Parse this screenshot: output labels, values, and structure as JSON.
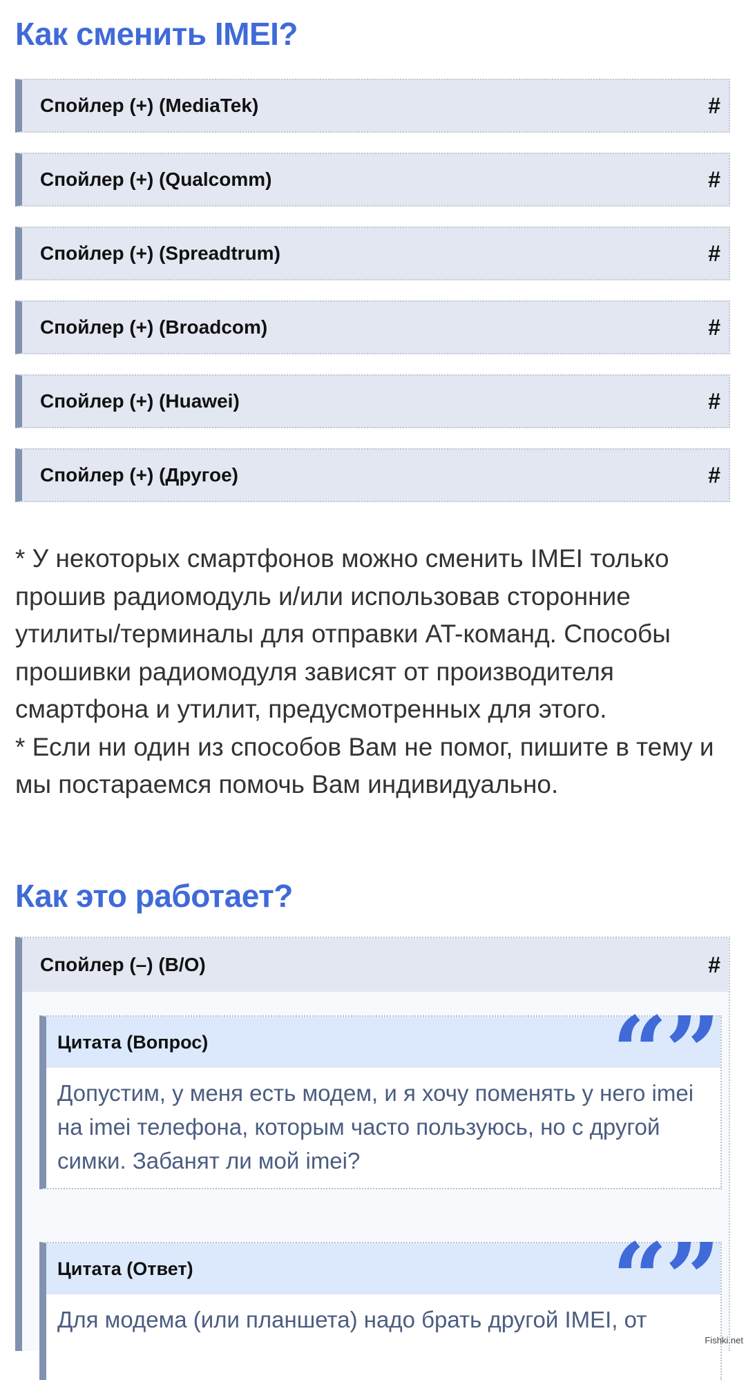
{
  "section1": {
    "title": "Как сменить IMEI?",
    "spoilers": [
      {
        "label": "Спойлер (+) (MediaTek)",
        "anchor": "#"
      },
      {
        "label": "Спойлер (+) (Qualcomm)",
        "anchor": "#"
      },
      {
        "label": "Спойлер (+) (Spreadtrum)",
        "anchor": "#"
      },
      {
        "label": "Спойлер (+) (Broadcom)",
        "anchor": "#"
      },
      {
        "label": "Спойлер (+) (Huawei)",
        "anchor": "#"
      },
      {
        "label": "Спойлер (+) (Другое)",
        "anchor": "#"
      }
    ],
    "notes": [
      "* У некоторых смартфонов можно сменить IMEI только прошив радиомодуль и/или использовав сторонние утилиты/терминалы для отправки AT-команд. Способы прошивки радиомодуля зависят от производителя смартфона и утилит, предусмотренных для этого.",
      "* Если ни один из способов Вам не помог, пишите в тему и мы постараемся помочь Вам индивидуально."
    ]
  },
  "section2": {
    "title": "Как это работает?",
    "spoiler": {
      "label": "Спойлер (–) (В/О)",
      "anchor": "#"
    },
    "quotes": [
      {
        "title": "Цитата (Вопрос)",
        "text": "Допустим, у меня есть модем, и я хочу поменять у него imei на imei телефона, которым часто пользуюсь, но с другой симки. Забанят ли мой imei?"
      },
      {
        "title": "Цитата (Ответ)",
        "text": "Для модема (или планшета) надо брать другой IMEI, от"
      }
    ],
    "quote_marks": "“”"
  },
  "watermark": "Fishki.net",
  "colors": {
    "heading": "#3f6ad8",
    "spoiler_bg": "#e3e7f1",
    "spoiler_border": "#8192b0",
    "quote_head_bg": "#dce9fc",
    "quote_text": "#4b5d80"
  },
  "icons": {
    "quote": "quote-marks-icon"
  }
}
